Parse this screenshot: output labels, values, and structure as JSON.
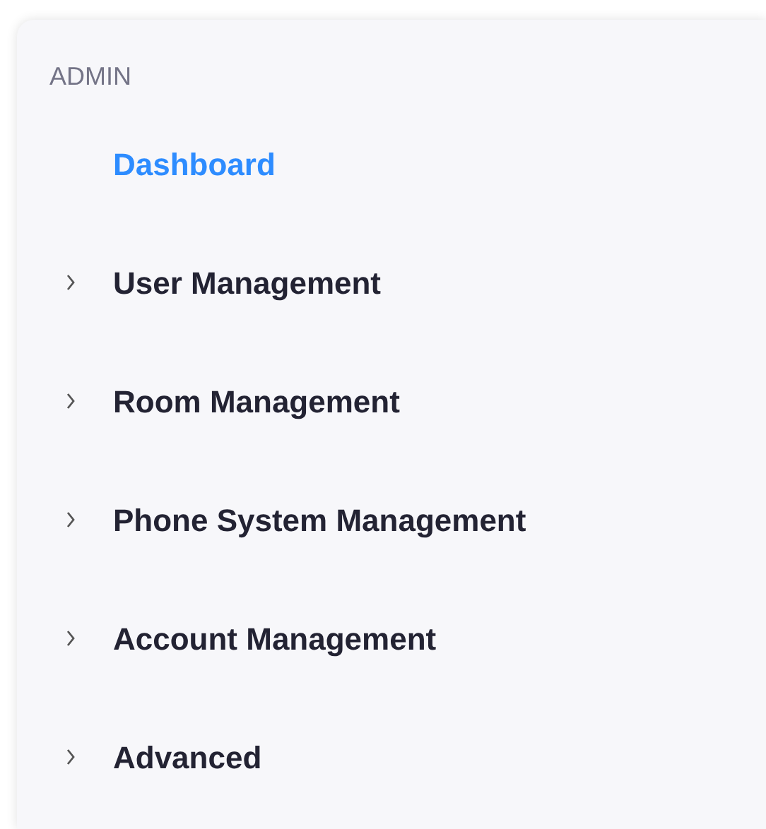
{
  "sidebar": {
    "heading": "ADMIN",
    "items": [
      {
        "label": "Dashboard",
        "kind": "link",
        "selected": true
      },
      {
        "label": "User Management",
        "kind": "group",
        "selected": false,
        "expanded": false
      },
      {
        "label": "Room Management",
        "kind": "group",
        "selected": false,
        "expanded": false
      },
      {
        "label": "Phone System Management",
        "kind": "group",
        "selected": false,
        "expanded": false
      },
      {
        "label": "Account Management",
        "kind": "group",
        "selected": false,
        "expanded": false
      },
      {
        "label": "Advanced",
        "kind": "group",
        "selected": false,
        "expanded": false
      }
    ]
  }
}
